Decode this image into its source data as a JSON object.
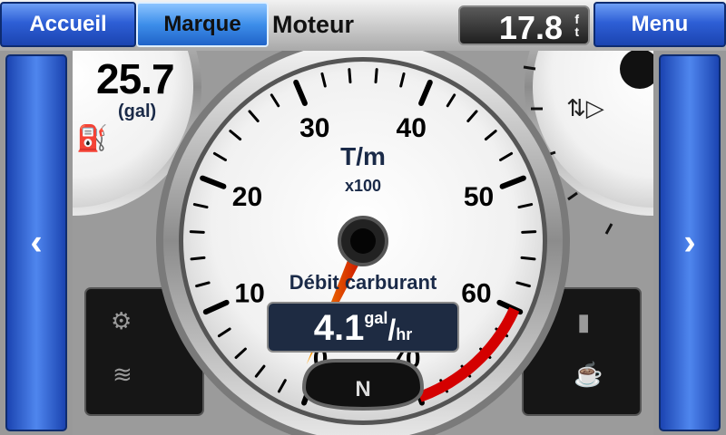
{
  "nav": {
    "home": "Accueil",
    "brand": "Marque",
    "menu": "Menu"
  },
  "title": "Moteur",
  "depth": {
    "value": "17.8",
    "unit_top": "f",
    "unit_bottom": "t"
  },
  "fuel": {
    "value": "25.7",
    "unit": "(gal)"
  },
  "tach": {
    "label": "T/m",
    "multiplier": "x100",
    "ticks": [
      "0",
      "10",
      "20",
      "30",
      "40",
      "50",
      "60",
      "70"
    ],
    "value": 1.0,
    "max": 70,
    "redline_start": 60
  },
  "fuel_flow": {
    "label": "Débit carburant",
    "value": "4.1",
    "unit_top": "gal",
    "unit_bottom": "hr"
  },
  "gear": "N",
  "icons": {
    "prev": "chevron-left-icon",
    "next": "chevron-right-icon",
    "fuel": "fuel-pump-icon",
    "trim": "boat-trim-icon",
    "engine": "check-engine-icon",
    "temp": "coolant-temp-icon",
    "battery": "battery-icon",
    "oil": "oil-can-icon"
  },
  "colors": {
    "accent": "#2e5fd6",
    "redline": "#d40000",
    "needle": "#ff5a00"
  }
}
